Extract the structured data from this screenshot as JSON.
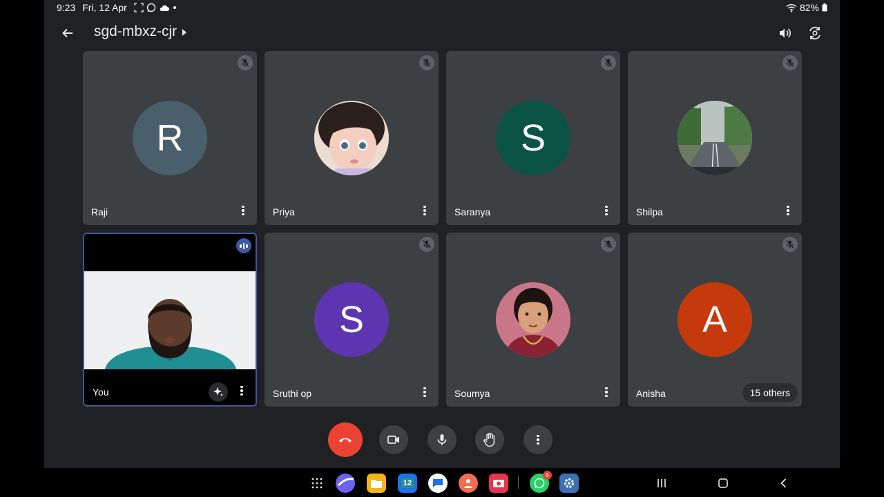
{
  "status_bar": {
    "time": "9:23",
    "date": "Fri, 12 Apr",
    "battery": "82%"
  },
  "meeting": {
    "title": "sgd-mbxz-cjr"
  },
  "participants": [
    {
      "name": "Raji",
      "initial": "R",
      "color": "#4a5f6c"
    },
    {
      "name": "Priya",
      "initial": "",
      "color": "#e9d9cf"
    },
    {
      "name": "Saranya",
      "initial": "S",
      "color": "#0b5345"
    },
    {
      "name": "Shilpa",
      "initial": "",
      "color": "#6f8f64"
    },
    {
      "name": "You",
      "initial": "",
      "color": "#000000"
    },
    {
      "name": "Sruthi op",
      "initial": "S",
      "color": "#5e35b1"
    },
    {
      "name": "Soumya",
      "initial": "",
      "color": "#b25b6a"
    },
    {
      "name": "Anisha",
      "initial": "A",
      "color": "#c53a0c"
    }
  ],
  "others_badge": "15 others",
  "nav_badge": "6",
  "calendar_day": "12",
  "colors": {
    "background": "#202124",
    "tile": "#3c4043",
    "end_call": "#ea4335",
    "self_border": "#3c5a9a"
  }
}
